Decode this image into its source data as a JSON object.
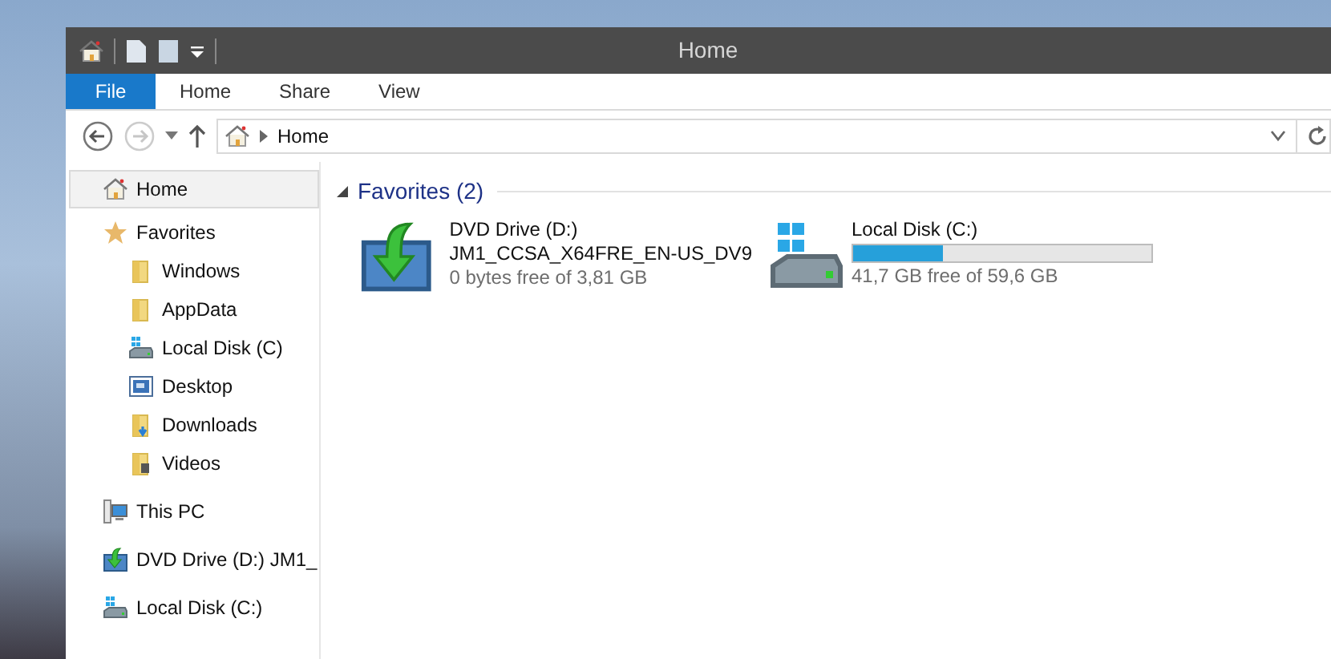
{
  "window": {
    "title": "Home"
  },
  "ribbon_tabs": [
    {
      "label": "File",
      "selected": true
    },
    {
      "label": "Home",
      "selected": false
    },
    {
      "label": "Share",
      "selected": false
    },
    {
      "label": "View",
      "selected": false
    }
  ],
  "address_bar": {
    "path": "Home"
  },
  "nav_pane": [
    {
      "label": "Home",
      "kind": "home",
      "selected": true
    },
    {
      "label": "Favorites",
      "kind": "star",
      "selected": false,
      "children": [
        {
          "label": "Windows",
          "kind": "folder",
          "selected": false
        },
        {
          "label": "AppData",
          "kind": "folder",
          "selected": false
        },
        {
          "label": "Local Disk (C)",
          "kind": "disk",
          "selected": false
        },
        {
          "label": "Desktop",
          "kind": "desktop",
          "selected": false
        },
        {
          "label": "Downloads",
          "kind": "downloads",
          "selected": false
        },
        {
          "label": "Videos",
          "kind": "videos",
          "selected": false
        }
      ]
    },
    {
      "label": "This PC",
      "kind": "pc",
      "selected": false
    },
    {
      "label": "DVD Drive (D:) JM1_",
      "kind": "dvd",
      "selected": false
    },
    {
      "label": "Local Disk (C:)",
      "kind": "disk",
      "selected": false
    }
  ],
  "group": {
    "title": "Favorites (2)",
    "expanded": true,
    "items": [
      {
        "kind": "dvd",
        "name": "DVD Drive (D:)",
        "label": "JM1_CCSA_X64FRE_EN-US_DV9",
        "free": "0 bytes free of 3,81 GB"
      },
      {
        "kind": "disk",
        "name": "Local Disk (C:)",
        "level": 0.3,
        "free": "41,7 GB free of 59,6 GB"
      }
    ]
  }
}
